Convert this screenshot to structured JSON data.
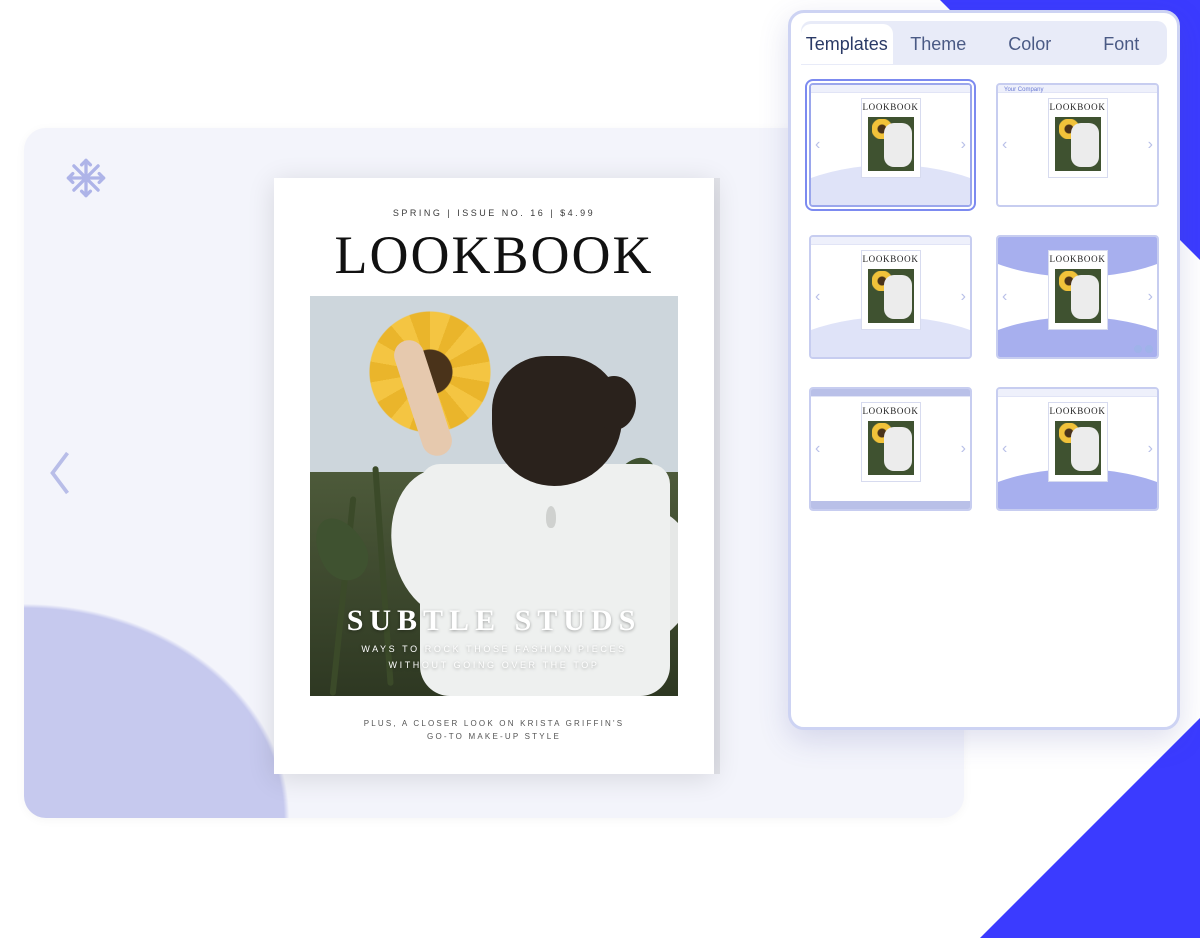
{
  "canvas": {
    "logo_name": "snowflake-logo",
    "toolbar_icons": [
      "globe-icon",
      "phone-icon",
      "location-icon"
    ]
  },
  "magazine": {
    "meta_line": "SPRING   | ISSUE NO. 16 | $4.99",
    "title": "LOOKBOOK",
    "headline": "SUBTLE STUDS",
    "sub1": "WAYS TO ROCK THOSE FASHION PIECES",
    "sub2": "WITHOUT GOING OVER THE TOP",
    "footer1": "PLUS, A CLOSER LOOK ON KRISTA GRIFFIN'S",
    "footer2": "GO-TO MAKE-UP STYLE"
  },
  "panel": {
    "tabs": [
      "Templates",
      "Theme",
      "Color",
      "Font"
    ],
    "active_tab_index": 0,
    "template_mini_title": "LOOKBOOK",
    "company_label": "Your Company",
    "selected_template_index": 0
  }
}
